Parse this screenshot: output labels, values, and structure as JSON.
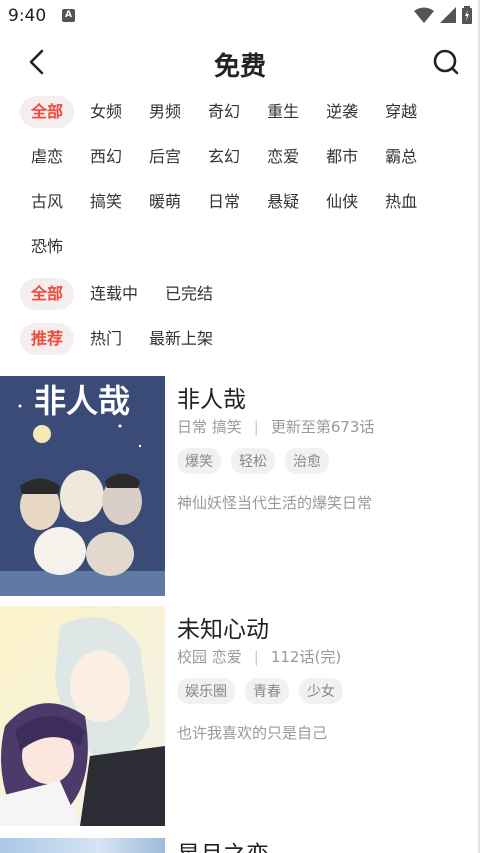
{
  "status_bar": {
    "time": "9:40",
    "app_icon": "A"
  },
  "nav": {
    "title": "免费",
    "back_icon": "chevron-left-icon",
    "search_icon": "search-icon"
  },
  "filters": {
    "category": [
      "全部",
      "女频",
      "男频",
      "奇幻",
      "重生",
      "逆袭",
      "穿越",
      "虐恋",
      "西幻",
      "后宫",
      "玄幻",
      "恋爱",
      "都市",
      "霸总",
      "古风",
      "搞笑",
      "暖萌",
      "日常",
      "悬疑",
      "仙侠",
      "热血",
      "恐怖"
    ],
    "status": [
      "全部",
      "连载中",
      "已完结"
    ],
    "sort": [
      "推荐",
      "热门",
      "最新上架"
    ]
  },
  "accent_color": "#ee4a3c",
  "books": [
    {
      "title": "非人哉",
      "genres": "日常 搞笑",
      "progress": "更新至第673话",
      "tags": [
        "爆笑",
        "轻松",
        "治愈"
      ],
      "description": "神仙妖怪当代生活的爆笑日常",
      "cover_text": "非人哉"
    },
    {
      "title": "未知心动",
      "genres": "校园 恋爱",
      "progress": "112话(完)",
      "tags": [
        "娱乐圈",
        "青春",
        "少女"
      ],
      "description": "也许我喜欢的只是自己"
    }
  ],
  "partial_book": {
    "title": "星月之恋"
  }
}
